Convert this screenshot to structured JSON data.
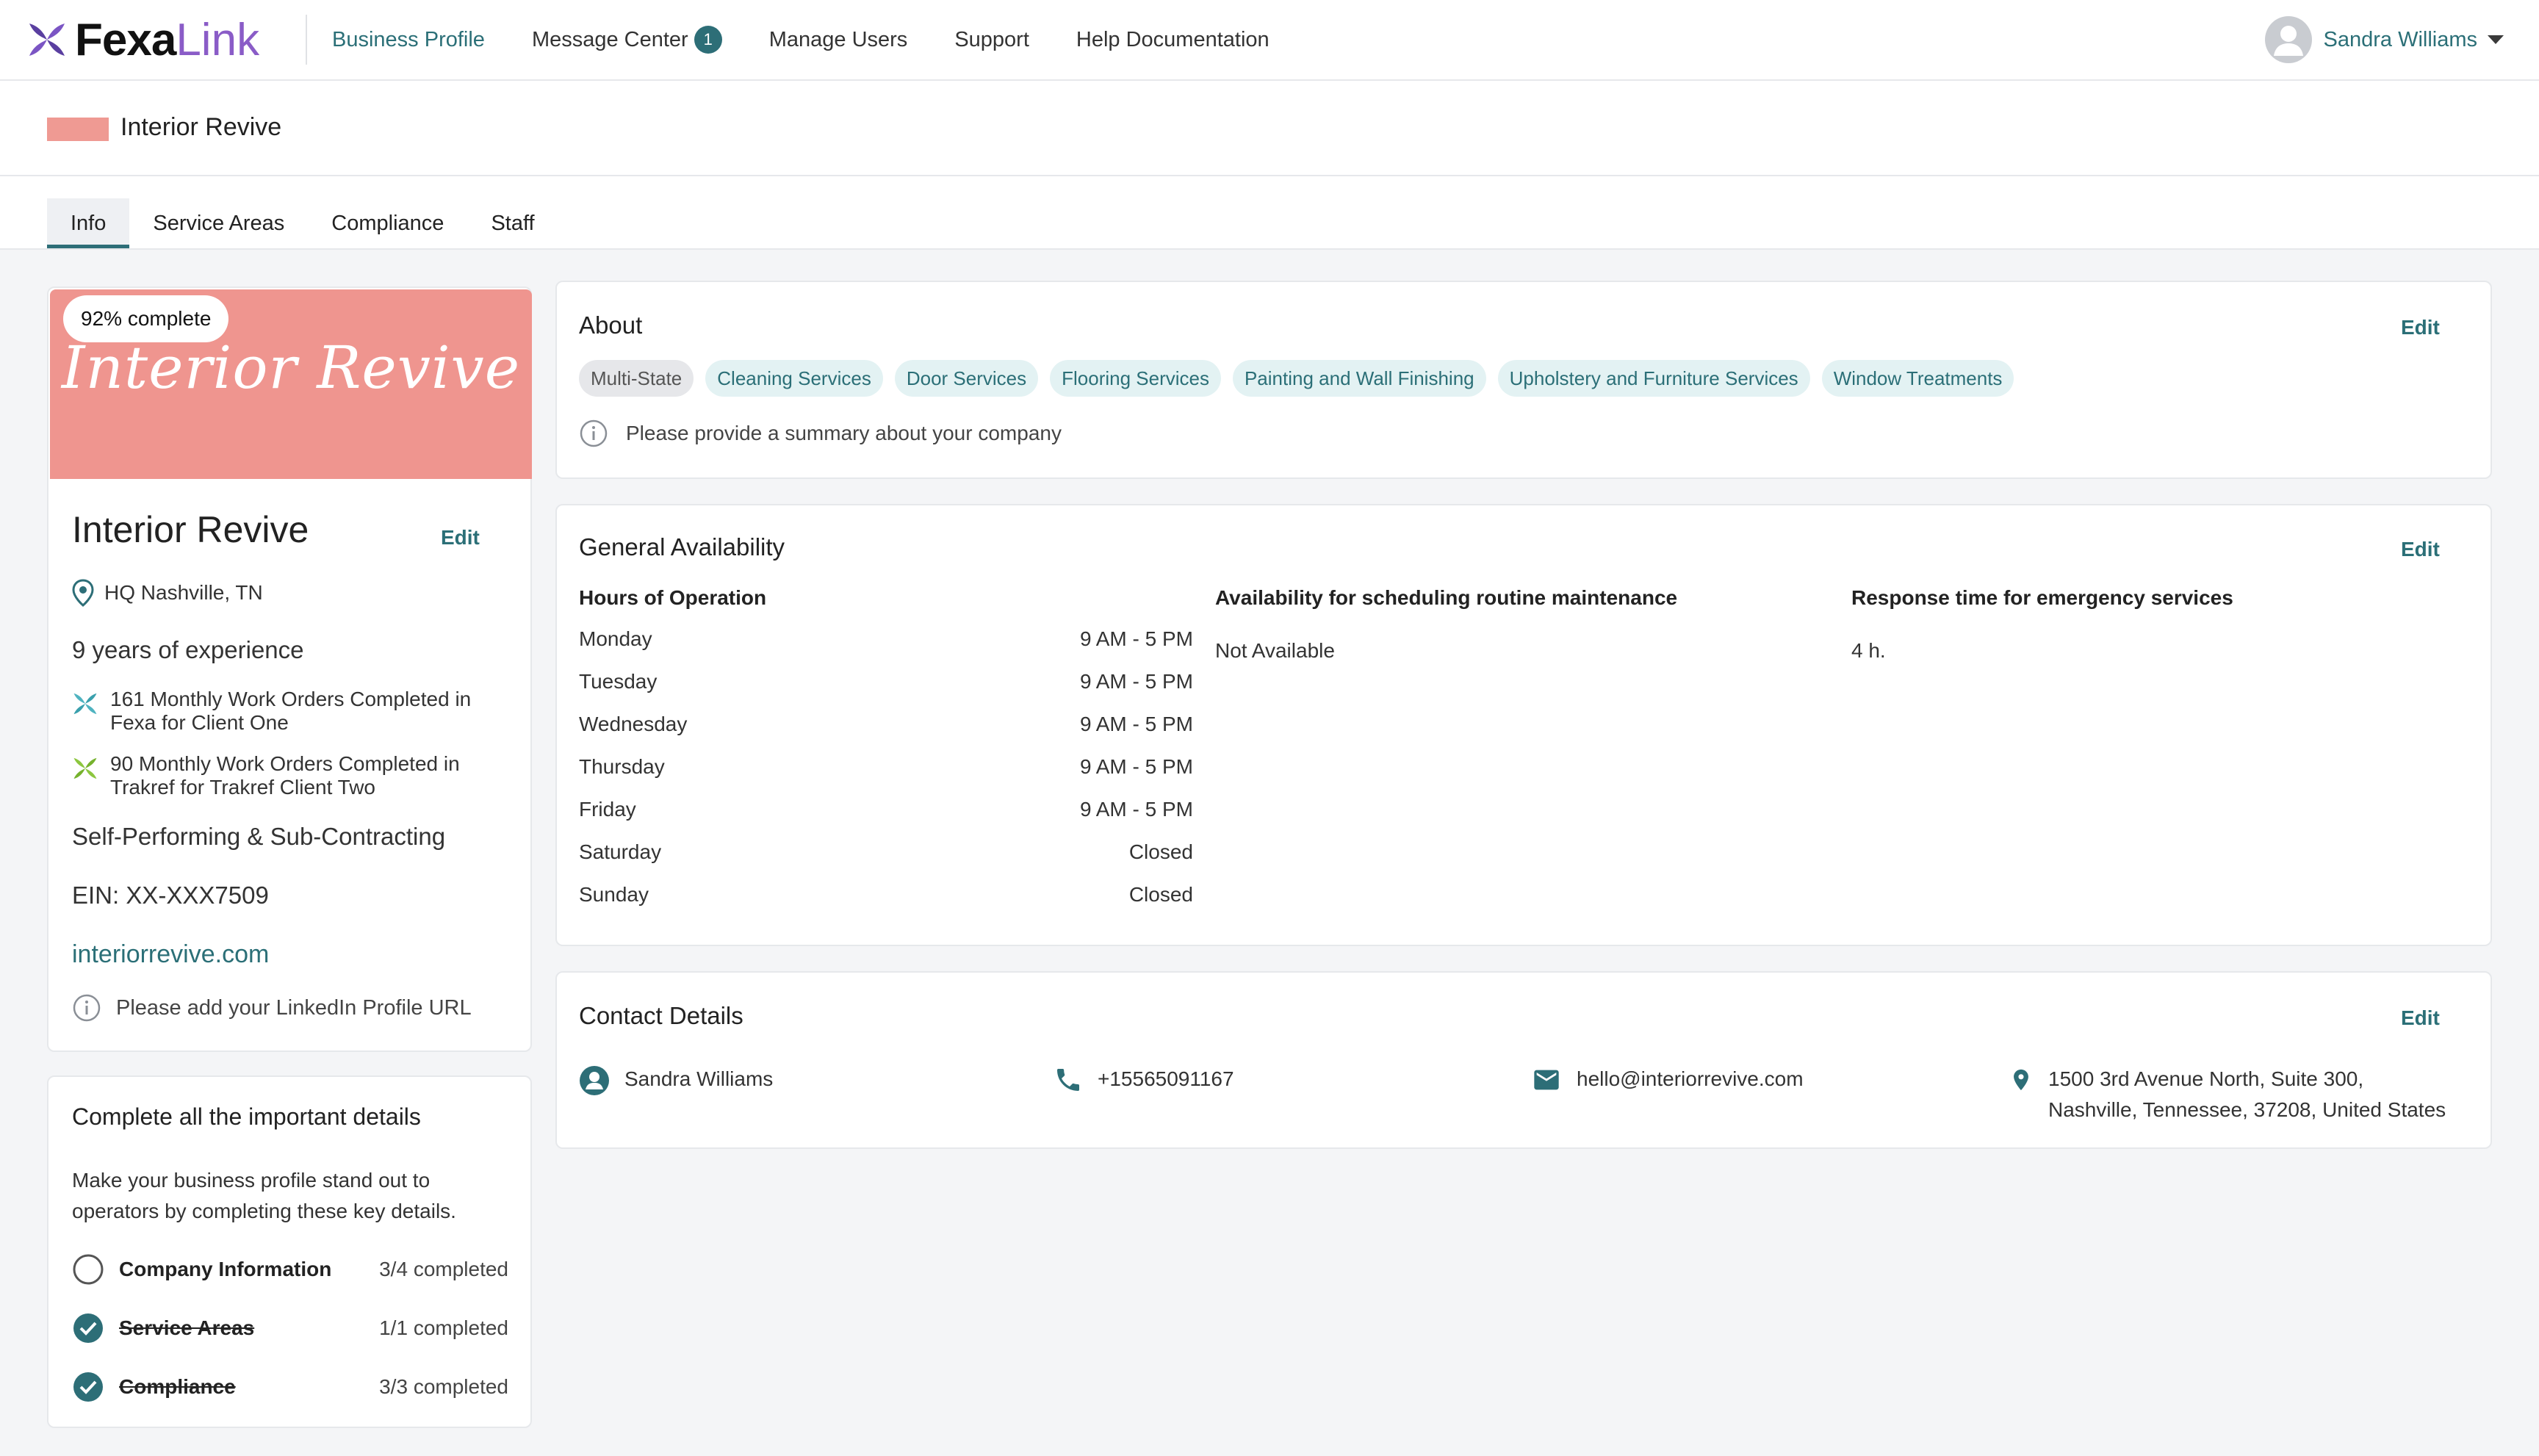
{
  "brand": {
    "name_part1": "Fexa",
    "name_part2": "Link"
  },
  "nav": {
    "items": [
      {
        "label": "Business Profile"
      },
      {
        "label": "Message Center",
        "badge": "1"
      },
      {
        "label": "Manage Users"
      },
      {
        "label": "Support"
      },
      {
        "label": "Help Documentation"
      }
    ],
    "user": "Sandra Williams"
  },
  "company_bar": {
    "title": "Interior Revive"
  },
  "tabs": [
    {
      "label": "Info",
      "active": true
    },
    {
      "label": "Service Areas"
    },
    {
      "label": "Compliance"
    },
    {
      "label": "Staff"
    }
  ],
  "profile": {
    "completeness": "92% complete",
    "banner_text": "Interior Revive",
    "name": "Interior Revive",
    "edit": "Edit",
    "location": "HQ Nashville, TN",
    "experience": "9 years of experience",
    "work_orders": [
      {
        "line1": "161 Monthly Work Orders Completed in",
        "line2": "Fexa for Client One",
        "color": "#4fb3c0"
      },
      {
        "line1": "90 Monthly Work Orders Completed in",
        "line2": "Trakref for Trakref Client Two",
        "color": "#8cc63f"
      }
    ],
    "mode": "Self-Performing & Sub-Contracting",
    "ein": "EIN: XX-XXX7509",
    "website": "interiorrevive.com",
    "linkedin_note": "Please add your LinkedIn Profile URL"
  },
  "checklist": {
    "title": "Complete all the important details",
    "description": "Make your business profile stand out to operators by completing these key details.",
    "items": [
      {
        "label": "Company Information",
        "count": "3/4 completed",
        "done": false
      },
      {
        "label": "Service Areas",
        "count": "1/1 completed",
        "done": true
      },
      {
        "label": "Compliance",
        "count": "3/3 completed",
        "done": true
      }
    ]
  },
  "about": {
    "title": "About",
    "edit": "Edit",
    "chips": [
      {
        "label": "Multi-State",
        "style": "grey"
      },
      {
        "label": "Cleaning Services",
        "style": "teal"
      },
      {
        "label": "Door Services",
        "style": "teal"
      },
      {
        "label": "Flooring Services",
        "style": "teal"
      },
      {
        "label": "Painting and Wall Finishing",
        "style": "teal"
      },
      {
        "label": "Upholstery and Furniture Services",
        "style": "teal"
      },
      {
        "label": "Window Treatments",
        "style": "teal"
      }
    ],
    "note": "Please provide a summary about your company"
  },
  "availability": {
    "title": "General Availability",
    "edit": "Edit",
    "hours_heading": "Hours of Operation",
    "hours": [
      {
        "day": "Monday",
        "time": "9 AM - 5 PM"
      },
      {
        "day": "Tuesday",
        "time": "9 AM - 5 PM"
      },
      {
        "day": "Wednesday",
        "time": "9 AM - 5 PM"
      },
      {
        "day": "Thursday",
        "time": "9 AM - 5 PM"
      },
      {
        "day": "Friday",
        "time": "9 AM - 5 PM"
      },
      {
        "day": "Saturday",
        "time": "Closed"
      },
      {
        "day": "Sunday",
        "time": "Closed"
      }
    ],
    "maintenance_heading": "Availability for scheduling routine maintenance",
    "maintenance_value": "Not Available",
    "emergency_heading": "Response time for emergency services",
    "emergency_value": "4 h."
  },
  "contact": {
    "title": "Contact Details",
    "edit": "Edit",
    "name": "Sandra Williams",
    "phone": "+15565091167",
    "email": "hello@interiorrevive.com",
    "address_line1": "1500 3rd Avenue North, Suite 300,",
    "address_line2": "Nashville, Tennessee, 37208, United States"
  },
  "colors": {
    "accent": "#2d6e77",
    "brand_purple": "#8a5cc7",
    "banner": "#ef958f"
  }
}
